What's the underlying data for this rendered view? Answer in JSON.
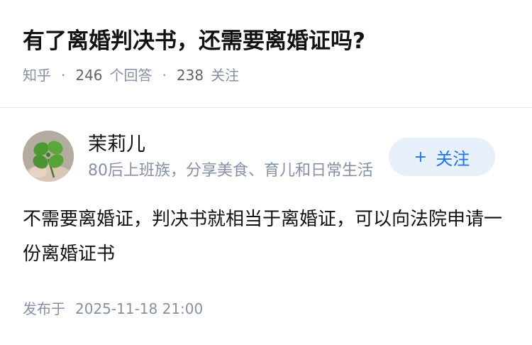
{
  "question": {
    "title": "有了离婚判决书，还需要离婚证吗?",
    "source": "知乎",
    "answer_count": "246",
    "answer_label": "个回答",
    "follower_count": "238",
    "follower_label": "关注",
    "separator": "·"
  },
  "author": {
    "name": "茉莉儿",
    "bio": "80后上班族，分享美食、育儿和日常生活",
    "avatar_icon": "four-leaf-clover-icon",
    "follow_plus": "+",
    "follow_label": "关注"
  },
  "answer": {
    "text": "不需要离婚证，判决书就相当于离婚证，可以向法院申请一份离婚证书"
  },
  "publish": {
    "label": "发布于",
    "time": "2025-11-18 21:00"
  },
  "colors": {
    "text": "#121212",
    "meta": "#8590a6",
    "brand_blue": "#1772f6",
    "follow_bg": "#e8f1fb",
    "divider": "#ebebeb"
  }
}
